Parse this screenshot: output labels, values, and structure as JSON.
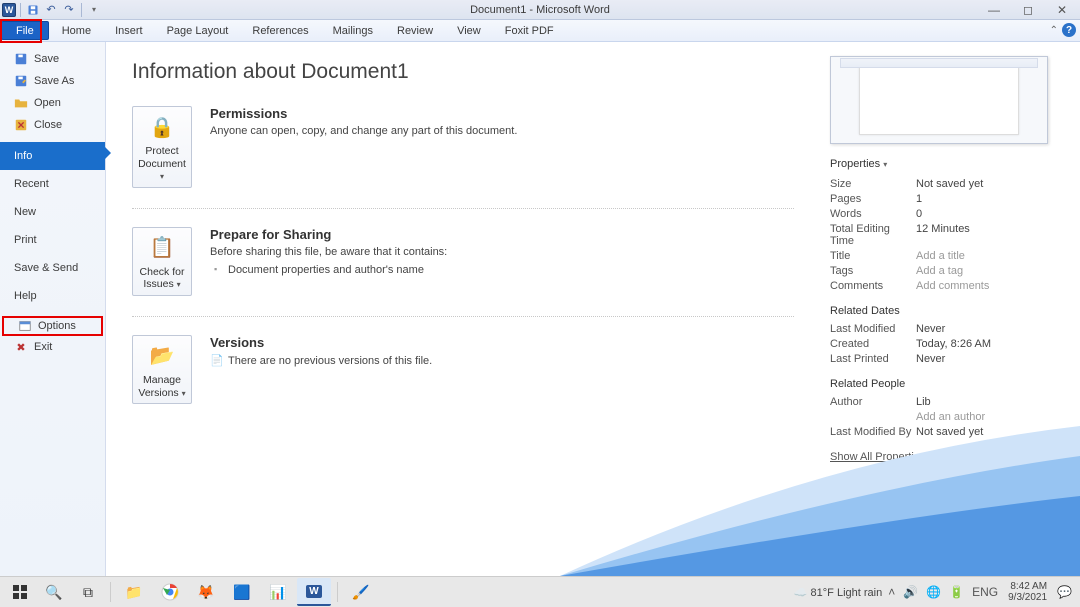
{
  "window": {
    "title": "Document1 - Microsoft Word"
  },
  "qat": {
    "undo": "↶",
    "redo": "↷"
  },
  "ribbon": {
    "tabs": [
      "File",
      "Home",
      "Insert",
      "Page Layout",
      "References",
      "Mailings",
      "Review",
      "View",
      "Foxit PDF"
    ]
  },
  "sidebar": {
    "topItems": [
      {
        "label": "Save",
        "icon": "save-icon"
      },
      {
        "label": "Save As",
        "icon": "save-icon"
      },
      {
        "label": "Open",
        "icon": "folder-icon"
      },
      {
        "label": "Close",
        "icon": "close-icon"
      }
    ],
    "navItems": [
      {
        "label": "Info",
        "selected": true
      },
      {
        "label": "Recent"
      },
      {
        "label": "New"
      },
      {
        "label": "Print"
      },
      {
        "label": "Save & Send"
      },
      {
        "label": "Help"
      }
    ],
    "bottomItems": [
      {
        "label": "Options",
        "icon": "options-icon",
        "highlight": true
      },
      {
        "label": "Exit",
        "icon": "exit-icon"
      }
    ]
  },
  "info": {
    "heading": "Information about Document1",
    "permissions": {
      "button": "Protect Document",
      "title": "Permissions",
      "desc": "Anyone can open, copy, and change any part of this document."
    },
    "sharing": {
      "button": "Check for Issues",
      "title": "Prepare for Sharing",
      "desc": "Before sharing this file, be aware that it contains:",
      "bullet1": "Document properties and author's name"
    },
    "versions": {
      "button": "Manage Versions",
      "title": "Versions",
      "desc": "There are no previous versions of this file."
    }
  },
  "properties": {
    "header": "Properties",
    "rows": [
      {
        "k": "Size",
        "v": "Not saved yet"
      },
      {
        "k": "Pages",
        "v": "1"
      },
      {
        "k": "Words",
        "v": "0"
      },
      {
        "k": "Total Editing Time",
        "v": "12 Minutes"
      },
      {
        "k": "Title",
        "v": "Add a title",
        "placeholder": true
      },
      {
        "k": "Tags",
        "v": "Add a tag",
        "placeholder": true
      },
      {
        "k": "Comments",
        "v": "Add comments",
        "placeholder": true
      }
    ],
    "relatedDatesTitle": "Related Dates",
    "dates": [
      {
        "k": "Last Modified",
        "v": "Never"
      },
      {
        "k": "Created",
        "v": "Today, 8:26 AM"
      },
      {
        "k": "Last Printed",
        "v": "Never"
      }
    ],
    "relatedPeopleTitle": "Related People",
    "author": {
      "k": "Author",
      "v": "Lib"
    },
    "addAuthor": "Add an author",
    "lastModBy": {
      "k": "Last Modified By",
      "v": "Not saved yet"
    },
    "showAll": "Show All Properties"
  },
  "taskbar": {
    "weather": "81°F  Light rain",
    "lang": "ENG",
    "time": "8:42 AM",
    "date": "9/3/2021"
  }
}
